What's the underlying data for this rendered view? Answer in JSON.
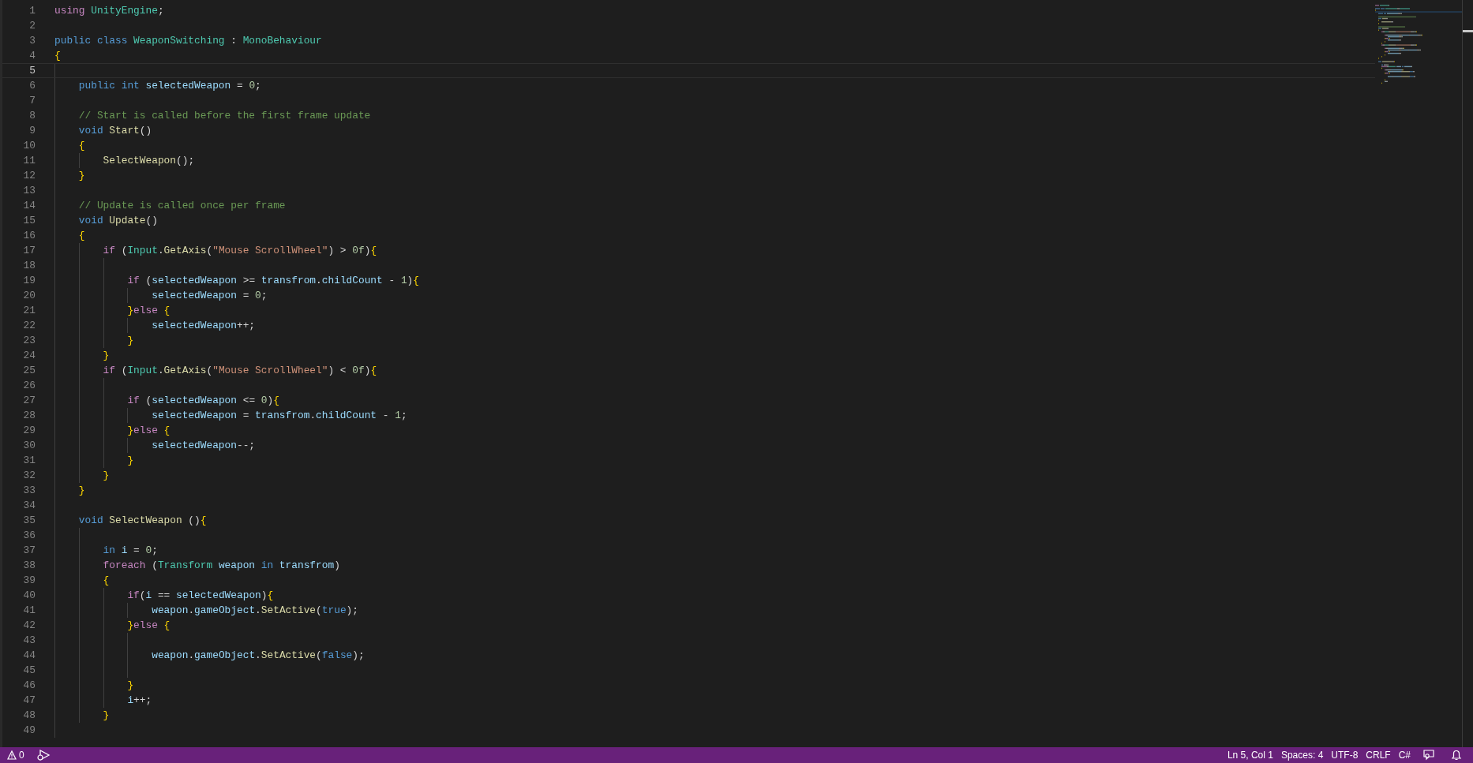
{
  "editor": {
    "lines": [
      {
        "number": "1",
        "active": false,
        "tokens": [
          {
            "kind": "control",
            "text": "using"
          },
          {
            "kind": "space"
          },
          {
            "kind": "type",
            "text": "UnityEngine"
          },
          {
            "kind": "plain",
            "text": ";"
          }
        ]
      },
      {
        "number": "2",
        "active": false
      },
      {
        "number": "3",
        "active": false,
        "tokens": [
          {
            "kind": "keyword",
            "text": "public"
          },
          {
            "kind": "space"
          },
          {
            "kind": "keyword",
            "text": "class"
          },
          {
            "kind": "space"
          },
          {
            "kind": "type",
            "text": "WeaponSwitching"
          },
          {
            "kind": "plain",
            "text": " : "
          },
          {
            "kind": "type",
            "text": "MonoBehaviour"
          }
        ]
      },
      {
        "number": "4",
        "active": false,
        "tokens": [
          {
            "kind": "brace",
            "text": "{"
          }
        ]
      },
      {
        "number": "5",
        "active": true
      },
      {
        "number": "6",
        "active": false,
        "tokens": [
          {
            "kind": "tab"
          },
          {
            "kind": "keyword",
            "text": "public"
          },
          {
            "kind": "space"
          },
          {
            "kind": "keyword",
            "text": "int"
          },
          {
            "kind": "space"
          },
          {
            "kind": "variable",
            "text": "selectedWeapon"
          },
          {
            "kind": "plain",
            "text": " = "
          },
          {
            "kind": "number",
            "text": "0"
          },
          {
            "kind": "plain",
            "text": ";"
          }
        ]
      },
      {
        "number": "7",
        "active": false
      },
      {
        "number": "8",
        "active": false,
        "tokens": [
          {
            "kind": "tab"
          },
          {
            "kind": "comment",
            "text": "// Start is called before the first frame update"
          }
        ]
      },
      {
        "number": "9",
        "active": false,
        "tokens": [
          {
            "kind": "tab"
          },
          {
            "kind": "keyword",
            "text": "void"
          },
          {
            "kind": "space"
          },
          {
            "kind": "function",
            "text": "Start"
          },
          {
            "kind": "plain",
            "text": "()"
          }
        ]
      },
      {
        "number": "10",
        "active": false,
        "tokens": [
          {
            "kind": "tab"
          },
          {
            "kind": "brace",
            "text": "{"
          }
        ]
      },
      {
        "number": "11",
        "active": false,
        "tokens": [
          {
            "kind": "tab"
          },
          {
            "kind": "tab"
          },
          {
            "kind": "function",
            "text": "SelectWeapon"
          },
          {
            "kind": "plain",
            "text": "();"
          }
        ]
      },
      {
        "number": "12",
        "active": false,
        "tokens": [
          {
            "kind": "tab"
          },
          {
            "kind": "brace",
            "text": "}"
          }
        ]
      },
      {
        "number": "13",
        "active": false
      },
      {
        "number": "14",
        "active": false,
        "tokens": [
          {
            "kind": "tab"
          },
          {
            "kind": "comment",
            "text": "// Update is called once per frame"
          }
        ]
      },
      {
        "number": "15",
        "active": false,
        "tokens": [
          {
            "kind": "tab"
          },
          {
            "kind": "keyword",
            "text": "void"
          },
          {
            "kind": "space"
          },
          {
            "kind": "function",
            "text": "Update"
          },
          {
            "kind": "plain",
            "text": "()"
          }
        ]
      },
      {
        "number": "16",
        "active": false,
        "tokens": [
          {
            "kind": "tab"
          },
          {
            "kind": "brace",
            "text": "{"
          }
        ]
      },
      {
        "number": "17",
        "active": false,
        "tokens": [
          {
            "kind": "tab"
          },
          {
            "kind": "tab"
          },
          {
            "kind": "control",
            "text": "if"
          },
          {
            "kind": "plain",
            "text": " ("
          },
          {
            "kind": "type",
            "text": "Input"
          },
          {
            "kind": "plain",
            "text": "."
          },
          {
            "kind": "function",
            "text": "GetAxis"
          },
          {
            "kind": "plain",
            "text": "("
          },
          {
            "kind": "string",
            "text": "\"Mouse ScrollWheel\""
          },
          {
            "kind": "plain",
            "text": ") > "
          },
          {
            "kind": "number",
            "text": "0f"
          },
          {
            "kind": "plain",
            "text": ")"
          },
          {
            "kind": "brace",
            "text": "{"
          }
        ]
      },
      {
        "number": "18",
        "active": false
      },
      {
        "number": "19",
        "active": false,
        "tokens": [
          {
            "kind": "tab"
          },
          {
            "kind": "tab"
          },
          {
            "kind": "tab"
          },
          {
            "kind": "control",
            "text": "if"
          },
          {
            "kind": "plain",
            "text": " ("
          },
          {
            "kind": "variable",
            "text": "selectedWeapon"
          },
          {
            "kind": "plain",
            "text": " >= "
          },
          {
            "kind": "variable",
            "text": "transfrom"
          },
          {
            "kind": "plain",
            "text": "."
          },
          {
            "kind": "variable",
            "text": "childCount"
          },
          {
            "kind": "plain",
            "text": " - "
          },
          {
            "kind": "number",
            "text": "1"
          },
          {
            "kind": "plain",
            "text": ")"
          },
          {
            "kind": "brace",
            "text": "{"
          }
        ]
      },
      {
        "number": "20",
        "active": false,
        "tokens": [
          {
            "kind": "tab"
          },
          {
            "kind": "tab"
          },
          {
            "kind": "tab"
          },
          {
            "kind": "tab"
          },
          {
            "kind": "variable",
            "text": "selectedWeapon"
          },
          {
            "kind": "plain",
            "text": " = "
          },
          {
            "kind": "number",
            "text": "0"
          },
          {
            "kind": "plain",
            "text": ";"
          }
        ]
      },
      {
        "number": "21",
        "active": false,
        "tokens": [
          {
            "kind": "tab"
          },
          {
            "kind": "tab"
          },
          {
            "kind": "tab"
          },
          {
            "kind": "brace",
            "text": "}"
          },
          {
            "kind": "control",
            "text": "else"
          },
          {
            "kind": "space"
          },
          {
            "kind": "brace",
            "text": "{"
          }
        ]
      },
      {
        "number": "22",
        "active": false,
        "tokens": [
          {
            "kind": "tab"
          },
          {
            "kind": "tab"
          },
          {
            "kind": "tab"
          },
          {
            "kind": "tab"
          },
          {
            "kind": "variable",
            "text": "selectedWeapon"
          },
          {
            "kind": "plain",
            "text": "++;"
          }
        ]
      },
      {
        "number": "23",
        "active": false,
        "tokens": [
          {
            "kind": "tab"
          },
          {
            "kind": "tab"
          },
          {
            "kind": "tab"
          },
          {
            "kind": "brace",
            "text": "}"
          }
        ]
      },
      {
        "number": "24",
        "active": false,
        "tokens": [
          {
            "kind": "tab"
          },
          {
            "kind": "tab"
          },
          {
            "kind": "brace",
            "text": "}"
          }
        ]
      },
      {
        "number": "25",
        "active": false,
        "tokens": [
          {
            "kind": "tab"
          },
          {
            "kind": "tab"
          },
          {
            "kind": "control",
            "text": "if"
          },
          {
            "kind": "plain",
            "text": " ("
          },
          {
            "kind": "type",
            "text": "Input"
          },
          {
            "kind": "plain",
            "text": "."
          },
          {
            "kind": "function",
            "text": "GetAxis"
          },
          {
            "kind": "plain",
            "text": "("
          },
          {
            "kind": "string",
            "text": "\"Mouse ScrollWheel\""
          },
          {
            "kind": "plain",
            "text": ") < "
          },
          {
            "kind": "number",
            "text": "0f"
          },
          {
            "kind": "plain",
            "text": ")"
          },
          {
            "kind": "brace",
            "text": "{"
          }
        ]
      },
      {
        "number": "26",
        "active": false
      },
      {
        "number": "27",
        "active": false,
        "tokens": [
          {
            "kind": "tab"
          },
          {
            "kind": "tab"
          },
          {
            "kind": "tab"
          },
          {
            "kind": "control",
            "text": "if"
          },
          {
            "kind": "plain",
            "text": " ("
          },
          {
            "kind": "variable",
            "text": "selectedWeapon"
          },
          {
            "kind": "plain",
            "text": " <= "
          },
          {
            "kind": "number",
            "text": "0"
          },
          {
            "kind": "plain",
            "text": ")"
          },
          {
            "kind": "brace",
            "text": "{"
          }
        ]
      },
      {
        "number": "28",
        "active": false,
        "tokens": [
          {
            "kind": "tab"
          },
          {
            "kind": "tab"
          },
          {
            "kind": "tab"
          },
          {
            "kind": "tab"
          },
          {
            "kind": "variable",
            "text": "selectedWeapon"
          },
          {
            "kind": "plain",
            "text": " = "
          },
          {
            "kind": "variable",
            "text": "transfrom"
          },
          {
            "kind": "plain",
            "text": "."
          },
          {
            "kind": "variable",
            "text": "childCount"
          },
          {
            "kind": "plain",
            "text": " - "
          },
          {
            "kind": "number",
            "text": "1"
          },
          {
            "kind": "plain",
            "text": ";"
          }
        ]
      },
      {
        "number": "29",
        "active": false,
        "tokens": [
          {
            "kind": "tab"
          },
          {
            "kind": "tab"
          },
          {
            "kind": "tab"
          },
          {
            "kind": "brace",
            "text": "}"
          },
          {
            "kind": "control",
            "text": "else"
          },
          {
            "kind": "space"
          },
          {
            "kind": "brace",
            "text": "{"
          }
        ]
      },
      {
        "number": "30",
        "active": false,
        "tokens": [
          {
            "kind": "tab"
          },
          {
            "kind": "tab"
          },
          {
            "kind": "tab"
          },
          {
            "kind": "tab"
          },
          {
            "kind": "variable",
            "text": "selectedWeapon"
          },
          {
            "kind": "plain",
            "text": "--;"
          }
        ]
      },
      {
        "number": "31",
        "active": false,
        "tokens": [
          {
            "kind": "tab"
          },
          {
            "kind": "tab"
          },
          {
            "kind": "tab"
          },
          {
            "kind": "brace",
            "text": "}"
          }
        ]
      },
      {
        "number": "32",
        "active": false,
        "tokens": [
          {
            "kind": "tab"
          },
          {
            "kind": "tab"
          },
          {
            "kind": "brace",
            "text": "}"
          }
        ]
      },
      {
        "number": "33",
        "active": false,
        "tokens": [
          {
            "kind": "tab"
          },
          {
            "kind": "brace",
            "text": "}"
          }
        ]
      },
      {
        "number": "34",
        "active": false
      },
      {
        "number": "35",
        "active": false,
        "tokens": [
          {
            "kind": "tab"
          },
          {
            "kind": "keyword",
            "text": "void"
          },
          {
            "kind": "space"
          },
          {
            "kind": "function",
            "text": "SelectWeapon"
          },
          {
            "kind": "plain",
            "text": " ()"
          },
          {
            "kind": "brace",
            "text": "{"
          }
        ]
      },
      {
        "number": "36",
        "active": false
      },
      {
        "number": "37",
        "active": false,
        "tokens": [
          {
            "kind": "tab"
          },
          {
            "kind": "tab"
          },
          {
            "kind": "keyword",
            "text": "in"
          },
          {
            "kind": "space"
          },
          {
            "kind": "variable",
            "text": "i"
          },
          {
            "kind": "plain",
            "text": " = "
          },
          {
            "kind": "number",
            "text": "0"
          },
          {
            "kind": "plain",
            "text": ";"
          }
        ]
      },
      {
        "number": "38",
        "active": false,
        "tokens": [
          {
            "kind": "tab"
          },
          {
            "kind": "tab"
          },
          {
            "kind": "control",
            "text": "foreach"
          },
          {
            "kind": "plain",
            "text": " ("
          },
          {
            "kind": "type",
            "text": "Transform"
          },
          {
            "kind": "space"
          },
          {
            "kind": "variable",
            "text": "weapon"
          },
          {
            "kind": "space"
          },
          {
            "kind": "keyword",
            "text": "in"
          },
          {
            "kind": "space"
          },
          {
            "kind": "variable",
            "text": "transfrom"
          },
          {
            "kind": "plain",
            "text": ")"
          }
        ]
      },
      {
        "number": "39",
        "active": false,
        "tokens": [
          {
            "kind": "tab"
          },
          {
            "kind": "tab"
          },
          {
            "kind": "brace",
            "text": "{"
          }
        ]
      },
      {
        "number": "40",
        "active": false,
        "tokens": [
          {
            "kind": "tab"
          },
          {
            "kind": "tab"
          },
          {
            "kind": "tab"
          },
          {
            "kind": "control",
            "text": "if"
          },
          {
            "kind": "plain",
            "text": "("
          },
          {
            "kind": "variable",
            "text": "i"
          },
          {
            "kind": "plain",
            "text": " == "
          },
          {
            "kind": "variable",
            "text": "selectedWeapon"
          },
          {
            "kind": "plain",
            "text": ")"
          },
          {
            "kind": "brace",
            "text": "{"
          }
        ]
      },
      {
        "number": "41",
        "active": false,
        "tokens": [
          {
            "kind": "tab"
          },
          {
            "kind": "tab"
          },
          {
            "kind": "tab"
          },
          {
            "kind": "tab"
          },
          {
            "kind": "variable",
            "text": "weapon"
          },
          {
            "kind": "plain",
            "text": "."
          },
          {
            "kind": "variable",
            "text": "gameObject"
          },
          {
            "kind": "plain",
            "text": "."
          },
          {
            "kind": "function",
            "text": "SetActive"
          },
          {
            "kind": "plain",
            "text": "("
          },
          {
            "kind": "keyword",
            "text": "true"
          },
          {
            "kind": "plain",
            "text": ");"
          }
        ]
      },
      {
        "number": "42",
        "active": false,
        "tokens": [
          {
            "kind": "tab"
          },
          {
            "kind": "tab"
          },
          {
            "kind": "tab"
          },
          {
            "kind": "brace",
            "text": "}"
          },
          {
            "kind": "control",
            "text": "else"
          },
          {
            "kind": "space"
          },
          {
            "kind": "brace",
            "text": "{"
          }
        ]
      },
      {
        "number": "43",
        "active": false
      },
      {
        "number": "44",
        "active": false,
        "tokens": [
          {
            "kind": "tab"
          },
          {
            "kind": "tab"
          },
          {
            "kind": "tab"
          },
          {
            "kind": "tab"
          },
          {
            "kind": "variable",
            "text": "weapon"
          },
          {
            "kind": "plain",
            "text": "."
          },
          {
            "kind": "variable",
            "text": "gameObject"
          },
          {
            "kind": "plain",
            "text": "."
          },
          {
            "kind": "function",
            "text": "SetActive"
          },
          {
            "kind": "plain",
            "text": "("
          },
          {
            "kind": "keyword",
            "text": "false"
          },
          {
            "kind": "plain",
            "text": ");"
          }
        ]
      },
      {
        "number": "45",
        "active": false
      },
      {
        "number": "46",
        "active": false,
        "tokens": [
          {
            "kind": "tab"
          },
          {
            "kind": "tab"
          },
          {
            "kind": "tab"
          },
          {
            "kind": "brace",
            "text": "}"
          }
        ]
      },
      {
        "number": "47",
        "active": false,
        "tokens": [
          {
            "kind": "tab"
          },
          {
            "kind": "tab"
          },
          {
            "kind": "tab"
          },
          {
            "kind": "variable",
            "text": "i"
          },
          {
            "kind": "plain",
            "text": "++;"
          }
        ]
      },
      {
        "number": "48",
        "active": false,
        "tokens": [
          {
            "kind": "tab"
          },
          {
            "kind": "tab"
          },
          {
            "kind": "brace",
            "text": "}"
          }
        ]
      },
      {
        "number": "49",
        "active": false
      }
    ]
  },
  "status_bar": {
    "problems": "0",
    "position": "Ln 5, Col 1",
    "indentation": "Spaces: 4",
    "encoding": "UTF-8",
    "line_ending": "CRLF",
    "language": "C#"
  }
}
